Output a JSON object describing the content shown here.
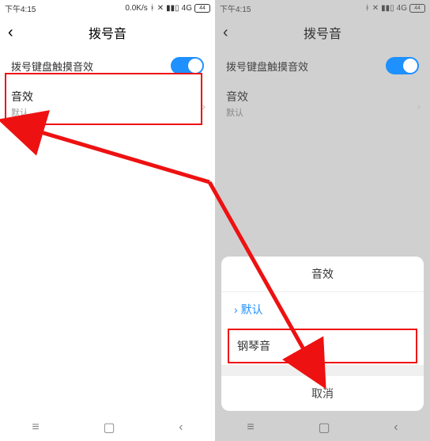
{
  "status": {
    "time": "下午4:15",
    "speed": "0.0K/s",
    "net": "4G",
    "battery": "44"
  },
  "titlebar": {
    "title": "拨号音"
  },
  "toggle_row": {
    "label": "拨号键盘触摸音效"
  },
  "setting": {
    "title": "音效",
    "subtitle": "默认"
  },
  "sheet": {
    "title": "音效",
    "opt_default": "默认",
    "opt_piano": "钢琴音",
    "cancel": "取消"
  }
}
